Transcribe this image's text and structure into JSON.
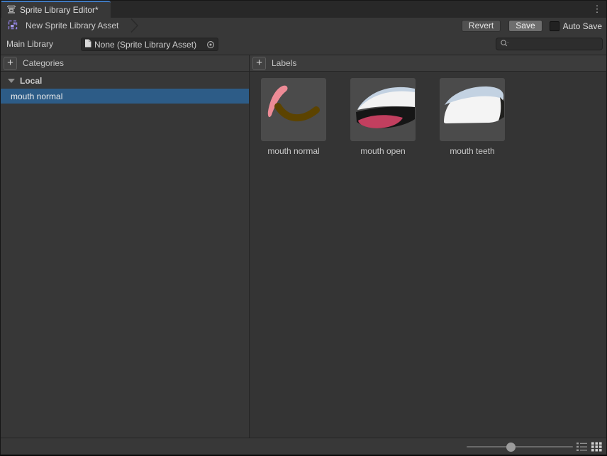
{
  "window": {
    "tab_title": "Sprite Library Editor*",
    "overflow_menu_glyph": "⋮"
  },
  "toolbar": {
    "breadcrumb_label": "New Sprite Library Asset",
    "revert_label": "Revert",
    "save_label": "Save",
    "auto_save_label": "Auto Save",
    "auto_save_checked": false
  },
  "library_row": {
    "label": "Main Library",
    "object_field_value": "None (Sprite Library Asset)",
    "search_value": "",
    "search_placeholder": ""
  },
  "categories_panel": {
    "header": "Categories",
    "add_button": "+",
    "group": {
      "label": "Local",
      "expanded": true
    },
    "items": [
      {
        "label": "mouth normal",
        "selected": true
      }
    ]
  },
  "labels_panel": {
    "header": "Labels",
    "add_button": "+",
    "items": [
      {
        "label": "mouth normal"
      },
      {
        "label": "mouth open"
      },
      {
        "label": "mouth teeth"
      }
    ]
  },
  "bottom_bar": {
    "slider_value_percent": 41,
    "active_view": "grid"
  },
  "colors": {
    "selection_blue": "#2d5c87",
    "tab_indicator_blue": "#4079bf",
    "sprite_pink": "#ed8b96",
    "sprite_brown": "#5c4300",
    "sprite_red": "#c23f5f",
    "sprite_blue_edge": "#c3d2e2"
  }
}
